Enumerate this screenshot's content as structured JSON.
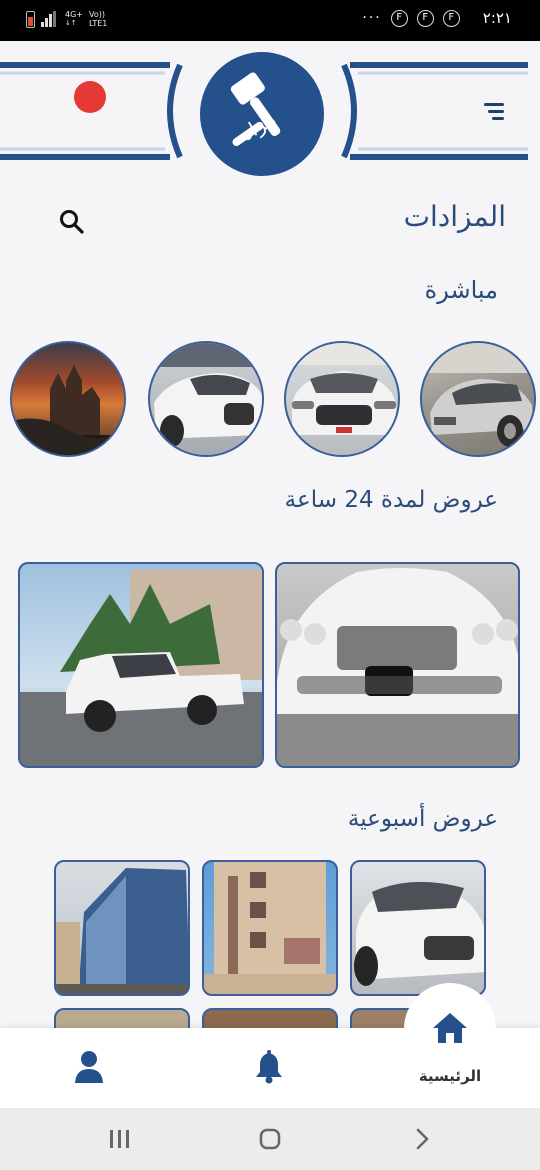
{
  "status_bar": {
    "network_top": "4G+",
    "network_bottom": "LTE1",
    "volte": "Vo))",
    "overflow": "···",
    "notif_letters": [
      "F",
      "F",
      "F"
    ],
    "time": "٢:٢١"
  },
  "header": {
    "logo_text": "مزاد",
    "brand_color": "#24508c",
    "record_dot_color": "#e53935"
  },
  "page": {
    "title": "المزادات",
    "live_label": "مباشرة",
    "offers_24h_label": "عروض لمدة 24 ساعة",
    "weekly_label": "عروض أسبوعية"
  },
  "live_items": [
    {
      "subject": "silver sedan",
      "icon": "car-image"
    },
    {
      "subject": "white sedan front",
      "icon": "car-image"
    },
    {
      "subject": "white sedan side",
      "icon": "car-image"
    },
    {
      "subject": "castle at sunset",
      "icon": "castle-image"
    }
  ],
  "offers_24h": [
    {
      "subject": "white luxury car",
      "icon": "car-image"
    },
    {
      "subject": "white pickup truck",
      "icon": "truck-image"
    }
  ],
  "weekly_offers": [
    {
      "subject": "white sedan",
      "icon": "car-image"
    },
    {
      "subject": "residential building",
      "icon": "building-image"
    },
    {
      "subject": "office tower",
      "icon": "building-image"
    }
  ],
  "bottom_nav": {
    "home_label": "الرئيسية",
    "items": [
      "home-icon",
      "bell-icon",
      "user-icon"
    ]
  }
}
